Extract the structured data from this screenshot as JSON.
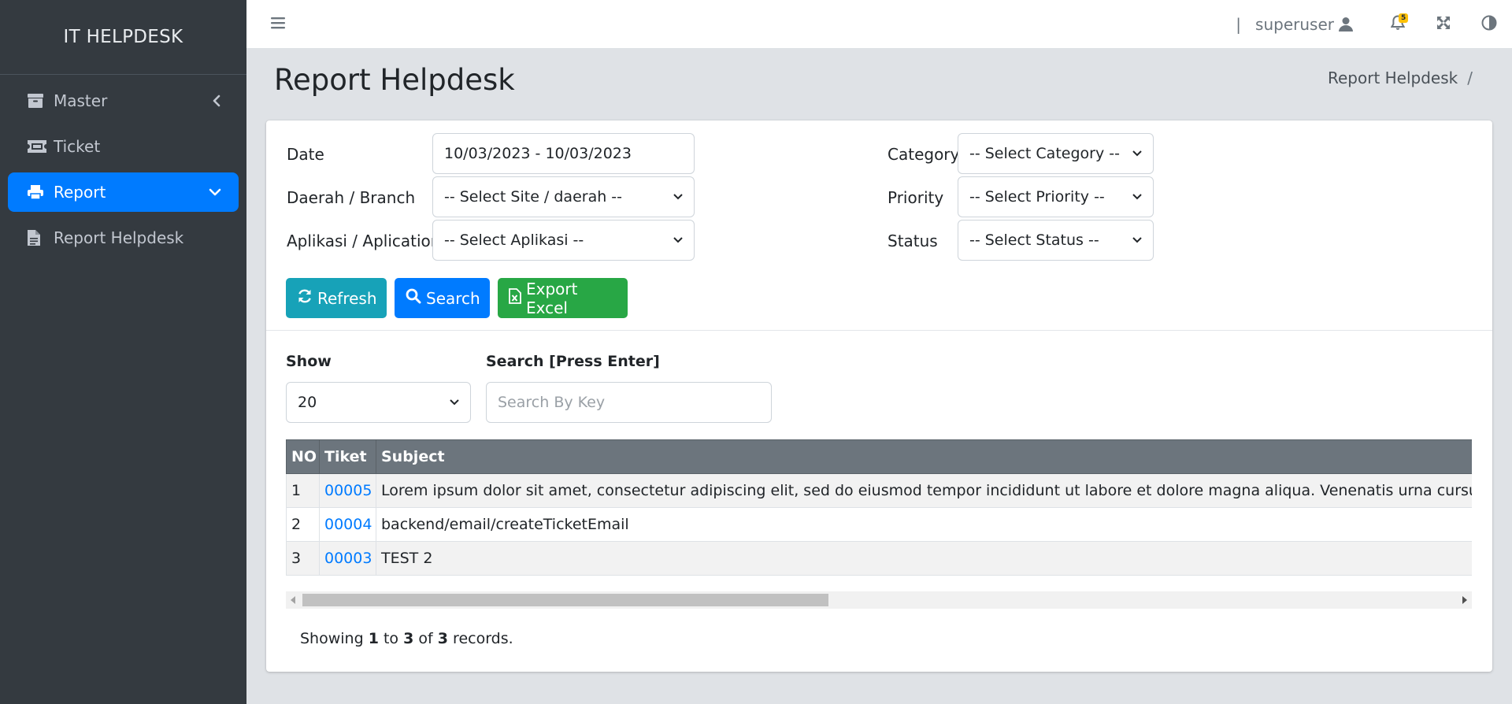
{
  "app": {
    "brand": "IT HELPDESK"
  },
  "sidebar": {
    "items": [
      {
        "label": "Master",
        "icon": "archive-icon",
        "chevron": "chevron-left-icon"
      },
      {
        "label": "Ticket",
        "icon": "ticket-icon"
      },
      {
        "label": "Report",
        "icon": "print-icon",
        "chevron": "chevron-down-icon",
        "active": true
      },
      {
        "label": "Report Helpdesk",
        "icon": "file-icon"
      }
    ]
  },
  "topbar": {
    "separator": "|",
    "username": "superuser",
    "notification_count": "5",
    "icons": [
      "menu-icon",
      "user-icon",
      "bell-icon",
      "fullscreen-icon",
      "theme-toggle-icon"
    ]
  },
  "header": {
    "title": "Report Helpdesk",
    "breadcrumb": [
      "Report Helpdesk",
      "/"
    ]
  },
  "filters": {
    "date_label": "Date",
    "date_value": "10/03/2023 - 10/03/2023",
    "branch_label": "Daerah / Branch",
    "branch_value": "-- Select Site / daerah --",
    "app_label": "Aplikasi / Aplication",
    "app_value": "-- Select Aplikasi --",
    "category_label": "Category",
    "category_value": "-- Select Category --",
    "priority_label": "Priority",
    "priority_value": "-- Select Priority --",
    "status_label": "Status",
    "status_value": "-- Select Status --"
  },
  "actions": {
    "refresh": "Refresh",
    "search": "Search",
    "export": "Export Excel"
  },
  "list_controls": {
    "show_label": "Show",
    "show_value": "20",
    "search_label": "Search [Press Enter]",
    "search_placeholder": "Search By Key"
  },
  "table": {
    "headers": [
      "NO",
      "Tiket",
      "Subject"
    ],
    "rows": [
      {
        "no": "1",
        "ticket": "00005",
        "subject": "Lorem ipsum dolor sit amet, consectetur adipiscing elit, sed do eiusmod tempor incididunt ut labore et dolore magna aliqua. Venenatis urna cursus ege"
      },
      {
        "no": "2",
        "ticket": "00004",
        "subject": "backend/email/createTicketEmail"
      },
      {
        "no": "3",
        "ticket": "00003",
        "subject": "TEST 2"
      }
    ]
  },
  "footer": {
    "showing_prefix": "Showing",
    "from": "1",
    "to_word": "to",
    "to": "3",
    "of_word": "of",
    "total": "3",
    "suffix": "records."
  },
  "colors": {
    "sidebar_bg": "#343a40",
    "active": "#007bff",
    "refresh": "#17a2b8",
    "export": "#28a745",
    "table_header": "#6c757d",
    "badge": "#ffc107"
  }
}
